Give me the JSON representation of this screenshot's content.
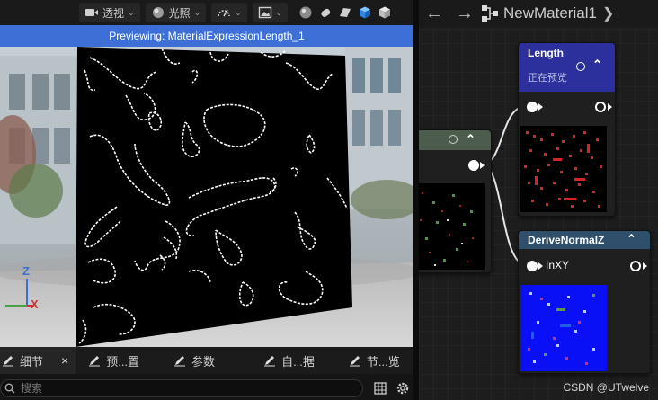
{
  "viewport": {
    "toolbar": {
      "perspective_label": "透视",
      "lit_label": "光照"
    },
    "preview_banner": "Previewing: MaterialExpressionLength_1",
    "axes": {
      "z": "Z",
      "x": "X"
    }
  },
  "details_tabs": [
    {
      "label": "细节",
      "close": "×"
    },
    {
      "label": "预...置"
    },
    {
      "label": "参数"
    },
    {
      "label": "自...据"
    },
    {
      "label": "节...览"
    }
  ],
  "search": {
    "placeholder": "搜索"
  },
  "graph": {
    "title": "NewMaterial1",
    "nodes": {
      "length": {
        "title": "Length",
        "subtitle": "正在预览",
        "header_color": "#2a2f9e"
      },
      "partial": {
        "header_color": "#4a5a4a"
      },
      "derive": {
        "title": "DeriveNormalZ",
        "pin_label": "InXY",
        "header_color": "#2f4f6a"
      }
    }
  },
  "watermark": "CSDN @UTwelve",
  "colors": {
    "accent": "#3d6fd6"
  }
}
